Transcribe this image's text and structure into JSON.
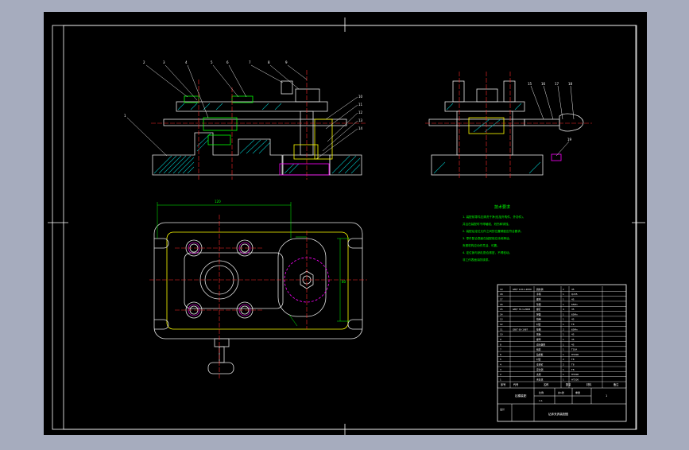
{
  "app": {
    "name": "CAD drawing viewer"
  },
  "drawing": {
    "background": "#000000",
    "sheet_color": "#ffffff",
    "viewport_color": "#a6acbe",
    "line_colors": {
      "outline": "#e6e6e6",
      "hatch": "#00b7b7",
      "green": "#00ff00",
      "yellow": "#ffff00",
      "red": "#ff2a2a",
      "magenta": "#ff00ff",
      "blue": "#5aa0ff"
    }
  },
  "views": {
    "front_section": {
      "balloons": [
        "2",
        "3",
        "4",
        "5",
        "6",
        "7",
        "8",
        "9"
      ],
      "left_balloon": "1",
      "right_balloons": [
        "10",
        "11",
        "12",
        "13",
        "14"
      ]
    },
    "side_view": {
      "balloons": [
        "15",
        "16",
        "17",
        "18"
      ],
      "lower_balloon": "19"
    },
    "top_view": {
      "dimension_top": "120",
      "dimension_right": "80"
    }
  },
  "tech_notes": {
    "title": "技术要求",
    "lines": [
      "1. 装配前零件应清洗干净(包括外购件、外协件)。",
      "   并且在装配时不得磕碰、划伤和锈蚀。",
      "2. 装配后定位元件之间的位置精度应符合要求。",
      "3. 零件配合表面在装配前应涂润滑油。",
      "   夹紧机构应动作灵活、可靠。",
      "4. 定位销与销孔配合紧密，不得松动。",
      "   非工作表面涂防锈漆。"
    ]
  },
  "title_block": {
    "rows": [
      [
        "19",
        "GB/T 119.1-2000",
        "圆柱销",
        "2",
        "45",
        ""
      ],
      [
        "18",
        "",
        "手柄",
        "1",
        "Q235",
        ""
      ],
      [
        "17",
        "",
        "螺母",
        "1",
        "45",
        ""
      ],
      [
        "16",
        "",
        "垫圈",
        "1",
        "65Mn",
        ""
      ],
      [
        "15",
        "GB/T 70.1-2008",
        "螺钉",
        "4",
        "35",
        ""
      ],
      [
        "14",
        "",
        "弹簧",
        "1",
        "65Mn",
        ""
      ],
      [
        "13",
        "",
        "挡销",
        "1",
        "45",
        ""
      ],
      [
        "12",
        "",
        "衬套",
        "1",
        "T8",
        ""
      ],
      [
        "11",
        "GB/T 93-1987",
        "垫圈",
        "2",
        "65Mn",
        ""
      ],
      [
        "10",
        "",
        "压板",
        "1",
        "45",
        ""
      ],
      [
        "9",
        "",
        "螺母",
        "1",
        "35",
        ""
      ],
      [
        "8",
        "",
        "双头螺柱",
        "1",
        "45",
        ""
      ],
      [
        "7",
        "",
        "钻套",
        "1",
        "T10A",
        ""
      ],
      [
        "6",
        "",
        "钻模板",
        "1",
        "HT200",
        ""
      ],
      [
        "5",
        "",
        "衬套",
        "2",
        "T8",
        ""
      ],
      [
        "4",
        "",
        "支承钉",
        "2",
        "T8",
        ""
      ],
      [
        "3",
        "",
        "定位销",
        "1",
        "T8",
        ""
      ],
      [
        "2",
        "",
        "支座",
        "1",
        "HT200",
        ""
      ],
      [
        "1",
        "",
        "夹具体",
        "1",
        "HT200",
        ""
      ]
    ],
    "header": {
      "seq": "序号",
      "code": "代号",
      "name": "名称",
      "qty": "数量",
      "material": "材料",
      "note": "备注"
    },
    "bottom": {
      "drawing_label": "钻模装配",
      "scale_label": "比例",
      "scale_value": "1:1",
      "sheet_label": "共1张",
      "weight_label": "重量",
      "mark": "1",
      "designer": "设计",
      "title": "钻床夹具装配图"
    }
  }
}
